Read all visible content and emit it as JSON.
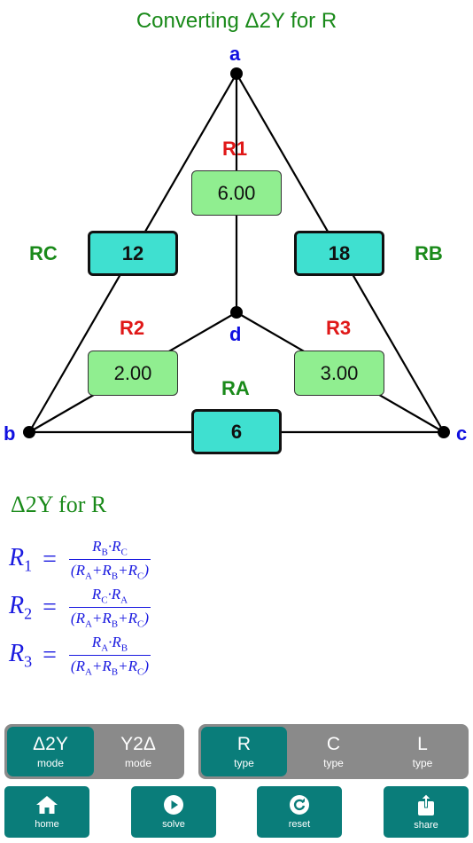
{
  "title": "Converting Δ2Y for R",
  "nodes": {
    "a": "a",
    "b": "b",
    "c": "c",
    "d": "d"
  },
  "delta_resistors": {
    "RA": {
      "label": "RA",
      "value": "6"
    },
    "RB": {
      "label": "RB",
      "value": "18"
    },
    "RC": {
      "label": "RC",
      "value": "12"
    }
  },
  "wye_resistors": {
    "R1": {
      "label": "R1",
      "value": "6.00"
    },
    "R2": {
      "label": "R2",
      "value": "2.00"
    },
    "R3": {
      "label": "R3",
      "value": "3.00"
    }
  },
  "formulas": {
    "title": "Δ2Y for R",
    "r1": {
      "lhs_base": "R",
      "lhs_sub": "1",
      "eq": "=",
      "num_a": "R",
      "num_a_sub": "B",
      "dot": "·",
      "num_b": "R",
      "num_b_sub": "C"
    },
    "r2": {
      "lhs_base": "R",
      "lhs_sub": "2",
      "eq": "=",
      "num_a": "R",
      "num_a_sub": "C",
      "dot": "·",
      "num_b": "R",
      "num_b_sub": "A"
    },
    "r3": {
      "lhs_base": "R",
      "lhs_sub": "3",
      "eq": "=",
      "num_a": "R",
      "num_a_sub": "A",
      "dot": "·",
      "num_b": "R",
      "num_b_sub": "B"
    },
    "den": {
      "open": "(",
      "r": "R",
      "sub_a": "A",
      "sub_b": "B",
      "sub_c": "C",
      "plus": "+",
      "close": ")"
    }
  },
  "mode_control": [
    {
      "label": "Δ2Y",
      "sub": "mode",
      "active": true
    },
    {
      "label": "Y2Δ",
      "sub": "mode",
      "active": false
    }
  ],
  "type_control": [
    {
      "label": "R",
      "sub": "type",
      "active": true
    },
    {
      "label": "C",
      "sub": "type",
      "active": false
    },
    {
      "label": "L",
      "sub": "type",
      "active": false
    }
  ],
  "toolbar": {
    "home": {
      "label": "home",
      "icon": "home-icon"
    },
    "solve": {
      "label": "solve",
      "icon": "play-icon"
    },
    "reset": {
      "label": "reset",
      "icon": "reset-icon"
    },
    "share": {
      "label": "share",
      "icon": "share-icon"
    }
  },
  "colors": {
    "title_green": "#1a8a1a",
    "node_blue": "#1010e0",
    "wye_red": "#e01818",
    "delta_box": "#3fe0d0",
    "wye_box": "#90ee90",
    "accent_teal": "#0a7d7a",
    "segment_gray": "#8a8a8a"
  }
}
